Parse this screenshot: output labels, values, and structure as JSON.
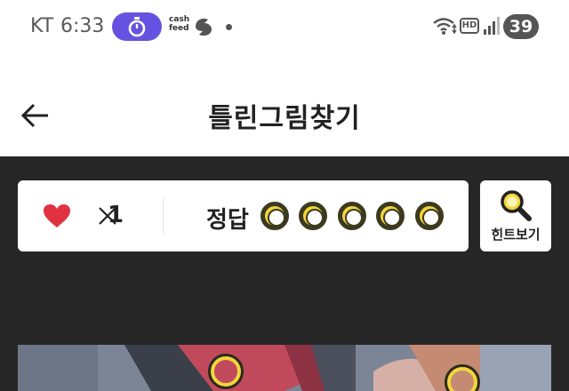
{
  "status_bar": {
    "carrier": "KT",
    "time": "6:33",
    "cashfeed_label": "cash feed",
    "battery_level": "39",
    "icons": [
      "timer-icon",
      "cashfeed-icon",
      "swirl-icon",
      "dot-icon",
      "wifi-icon",
      "hd-icon",
      "signal-icon",
      "battery-icon"
    ]
  },
  "header": {
    "title": "틀린그림찾기",
    "back_icon": "back-arrow-icon"
  },
  "score_card": {
    "lives_icon": "heart-icon",
    "lives_multiplier": "×",
    "lives_count": "1",
    "answer_label": "정답",
    "answer_slots_total": 5,
    "answer_slots_found": 0
  },
  "hint_button": {
    "label": "힌트보기",
    "icon": "magnifier-icon"
  },
  "puzzle": {
    "markers_visible": 2
  },
  "colors": {
    "dark_bg": "#262626",
    "accent_yellow": "#f2d43c",
    "heart_red": "#e0323f",
    "timer_purple": "#6652e0"
  }
}
